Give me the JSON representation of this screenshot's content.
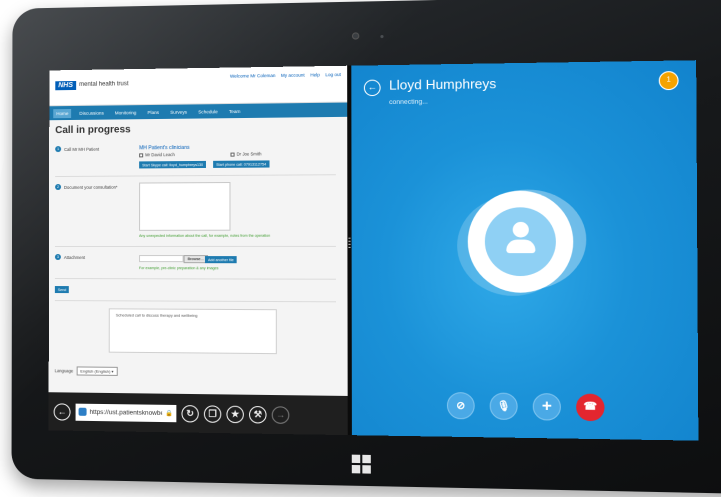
{
  "web": {
    "header": {
      "logo": "NHS",
      "trust_name": "mental health trust",
      "links": [
        "Welcome Mr Coleman",
        "My account",
        "Help",
        "Log out"
      ]
    },
    "nav": [
      "Home",
      "Discussions",
      "Monitoring",
      "Plans",
      "Surveys",
      "Schedule",
      "Team"
    ],
    "page_title": "Call in progress",
    "steps": {
      "call_patient": "Call Mr MH Patient",
      "document": "Document your consultation*",
      "attachment": "Attachment"
    },
    "clinicians": {
      "title": "MH Patient's clinicians",
      "items": [
        "Mr David Leach",
        "Dr Joe Smith"
      ]
    },
    "buttons": {
      "start_skype": "Start Skype call: lloyd_humphreys130",
      "start_phone": "Start phone call: 07913112754",
      "browse": "Browse...",
      "add_file": "Add another file",
      "send": "Send"
    },
    "hints": {
      "document": "Any unexpected information about the call, for example, notes from the operation",
      "attachment": "For example, pre-clinic preparation & any images"
    },
    "transcript": "Scheduled call to discuss therapy and wellbeing",
    "language": {
      "label": "Language",
      "value": "English (English)"
    }
  },
  "browser": {
    "url": "https://ust.patientsknowbest.com"
  },
  "call": {
    "caller_name": "Lloyd Humphreys",
    "status": "connecting...",
    "notification_count": "1"
  },
  "colors": {
    "skype_blue": "#1b92d8",
    "nhs_blue": "#005eb8",
    "nav_blue": "#1e7bb0",
    "end_call_red": "#e3262f",
    "badge_orange": "#f5a300"
  }
}
